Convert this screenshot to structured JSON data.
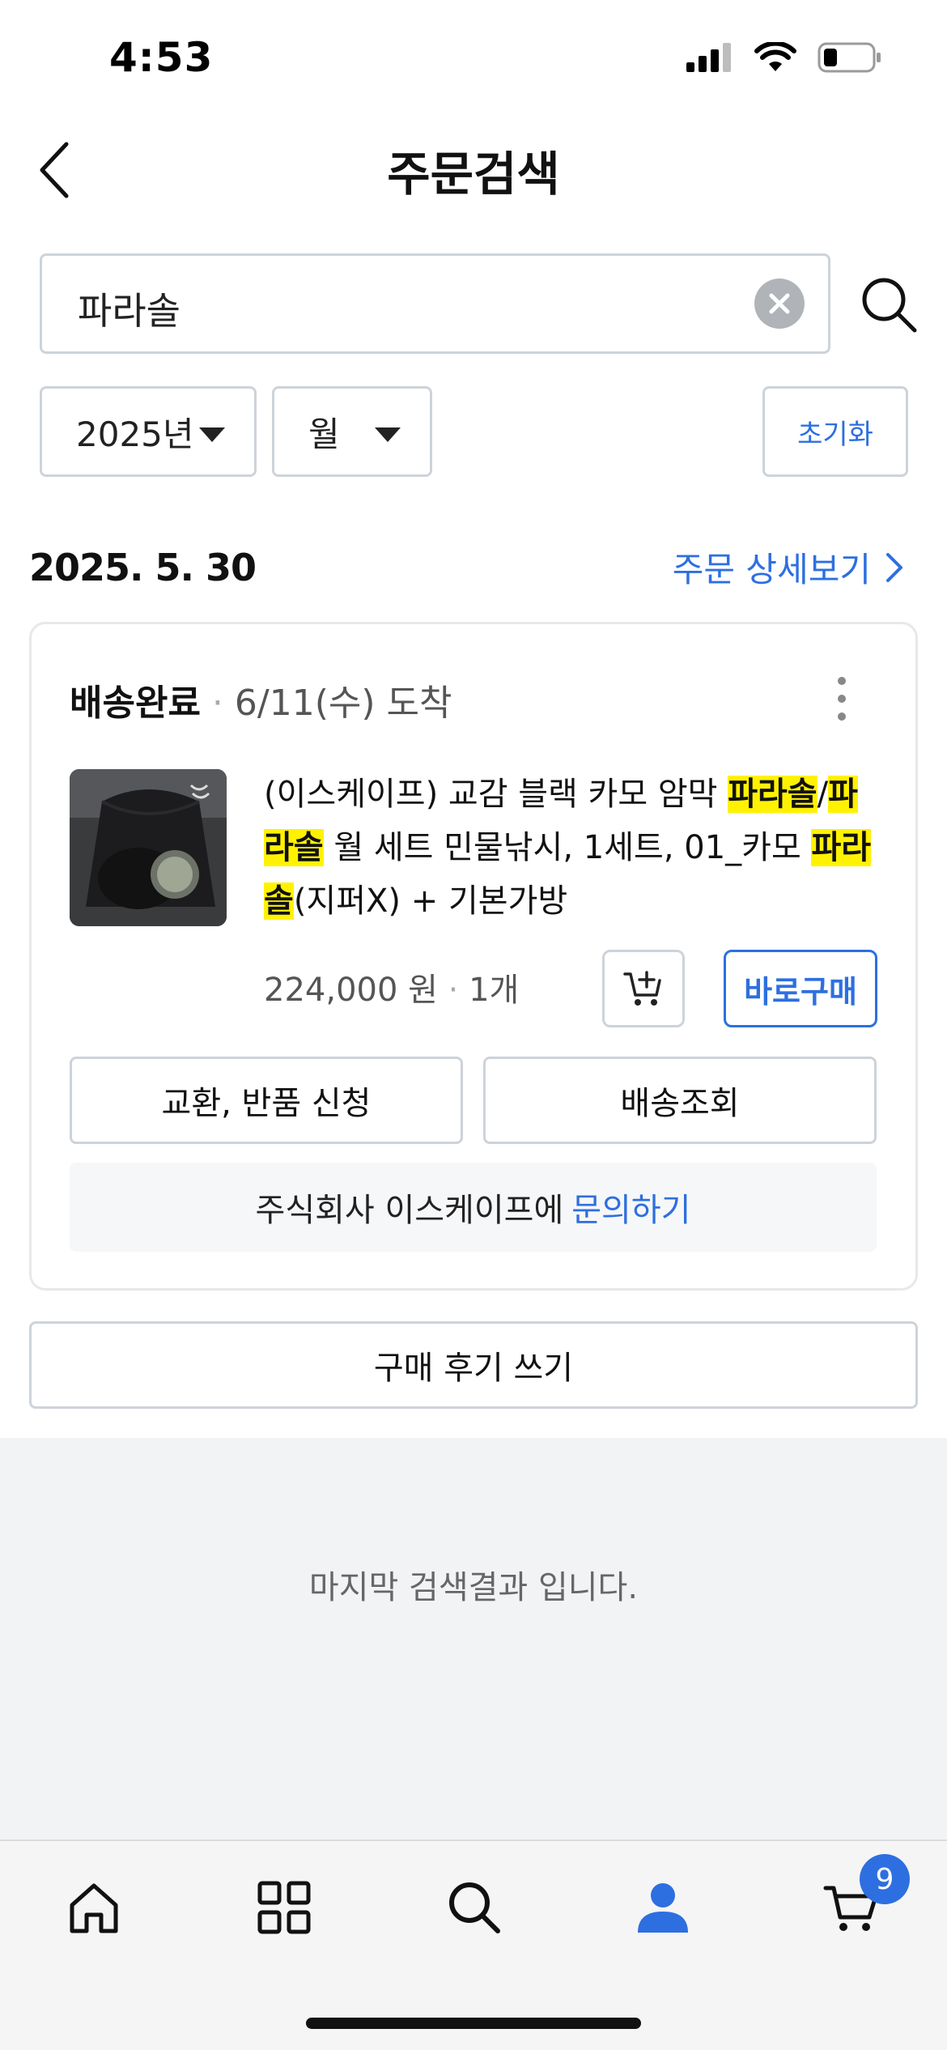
{
  "status_bar": {
    "time": "4:53"
  },
  "header": {
    "title": "주문검색"
  },
  "search": {
    "query": "파라솔"
  },
  "filters": {
    "year": "2025년",
    "month": "월",
    "reset_label": "초기화"
  },
  "order": {
    "date": "2025. 5. 30",
    "detail_link": "주문 상세보기",
    "status": "배송완료",
    "separator": "·",
    "arrival": "6/11(수) 도착",
    "product": {
      "name_parts": [
        {
          "text": "(이스케이프) 교감 블랙 카모 암막 ",
          "highlight": false
        },
        {
          "text": "파라솔",
          "highlight": true
        },
        {
          "text": "/",
          "highlight": false
        },
        {
          "text": "파라솔",
          "highlight": true
        },
        {
          "text": " 월 세트 민물낚시, 1세트, 01_카모 ",
          "highlight": false
        },
        {
          "text": "파라솔",
          "highlight": true
        },
        {
          "text": "(지퍼X) + 기본가방",
          "highlight": false
        }
      ],
      "price": "224,000 원",
      "quantity": "1개"
    },
    "buy_now_label": "바로구매",
    "exchange_label": "교환, 반품 신청",
    "tracking_label": "배송조회",
    "inquiry_text": "주식회사 이스케이프에",
    "inquiry_link": "문의하기"
  },
  "review_label": "구매 후기 쓰기",
  "end_message": "마지막 검색결과 입니다.",
  "tabbar": {
    "cart_badge": "9",
    "active_tab": "my"
  },
  "colors": {
    "accent": "#2d6fe0",
    "highlight": "#fff200",
    "border": "#cdd3da"
  }
}
